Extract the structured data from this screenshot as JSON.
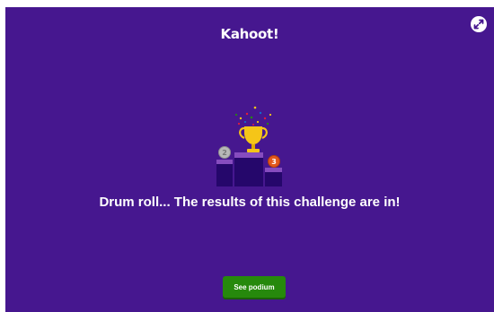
{
  "brand": {
    "logo_text": "Kahoot!"
  },
  "controls": {
    "fullscreen_icon": "expand-arrows-icon"
  },
  "podium": {
    "icon": "trophy-podium-icon",
    "second_place": "2",
    "first_place": "1",
    "third_place": "3"
  },
  "main": {
    "headline": "Drum roll... The results of this challenge are in!",
    "see_podium_label": "See podium"
  },
  "colors": {
    "background": "#46178f",
    "button_green": "#26890c",
    "trophy_gold": "#f5c518",
    "silver": "#b8b8b8",
    "bronze": "#e2581d"
  }
}
